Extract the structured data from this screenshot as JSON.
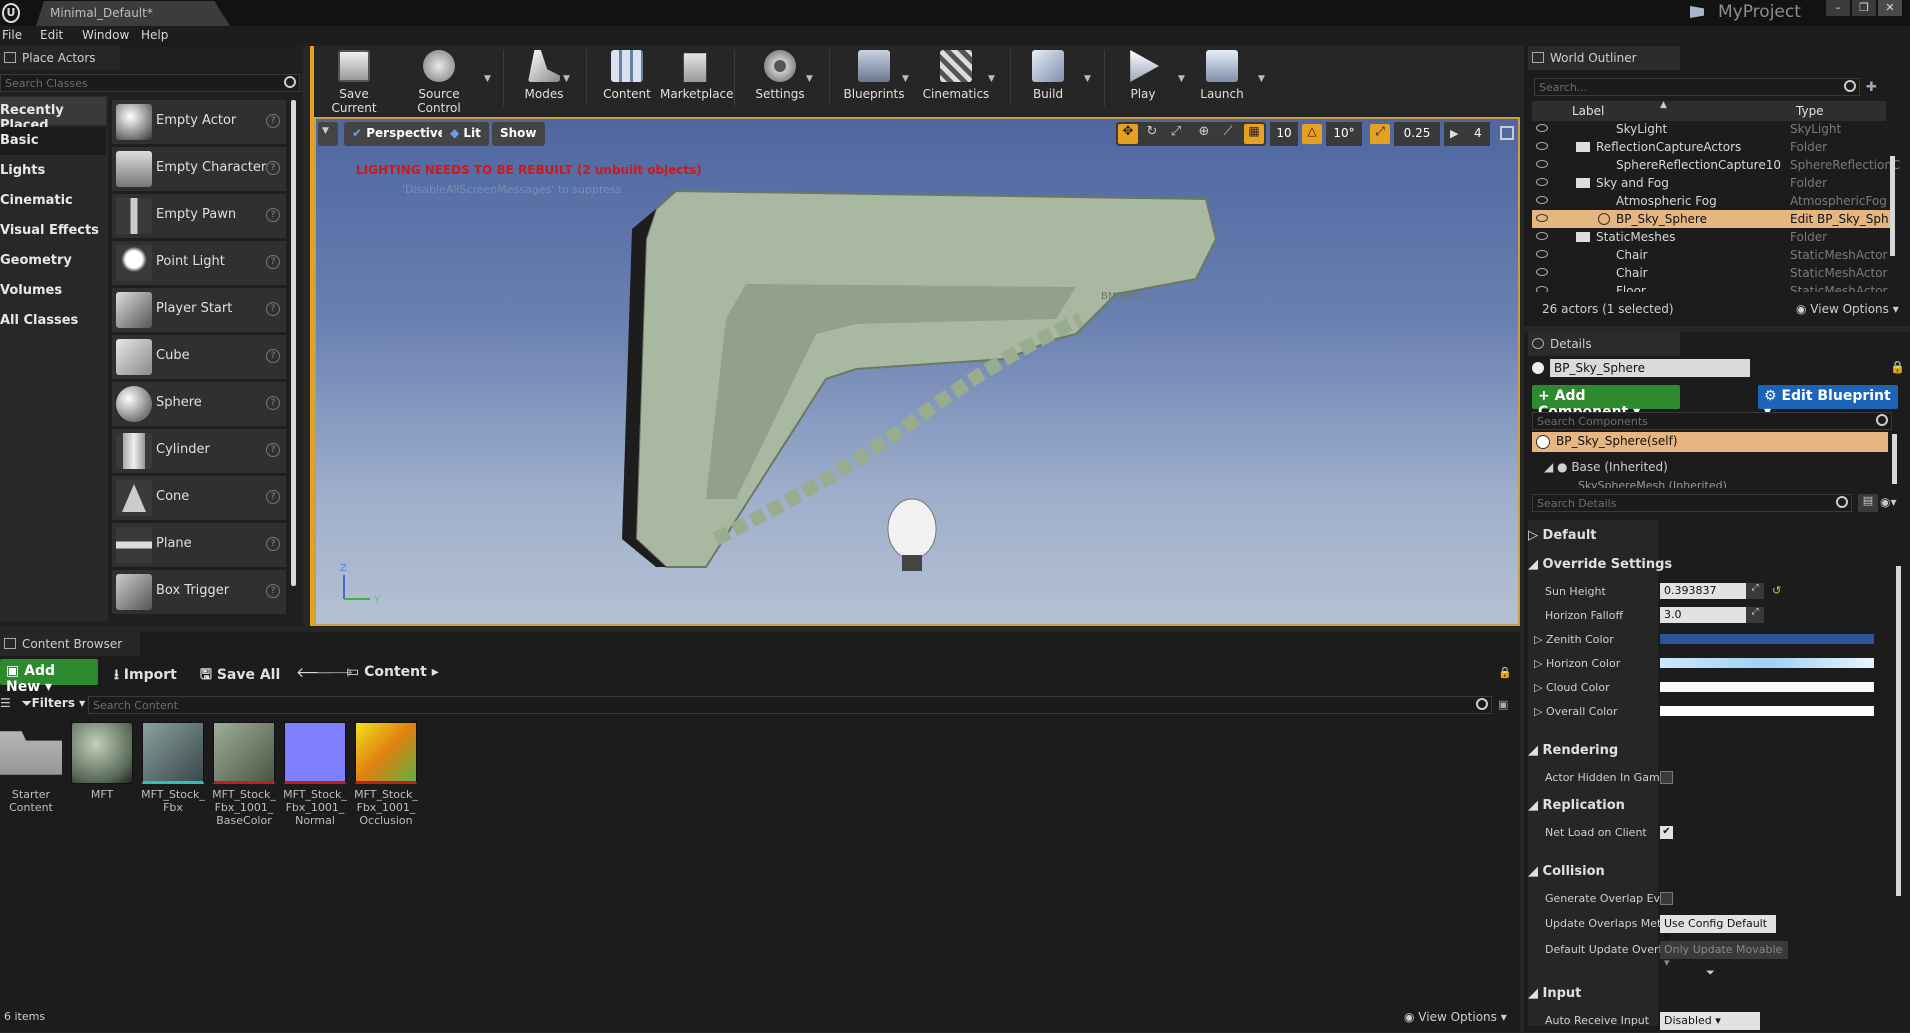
{
  "window": {
    "tab_title": "Minimal_Default*",
    "project": "MyProject",
    "controls": [
      "–",
      "❐",
      "✕"
    ]
  },
  "menu": [
    "File",
    "Edit",
    "Window",
    "Help"
  ],
  "place_actors": {
    "tab": "Place Actors",
    "search_placeholder": "Search Classes",
    "categories": [
      "Recently Placed",
      "Basic",
      "Lights",
      "Cinematic",
      "Visual Effects",
      "Geometry",
      "Volumes",
      "All Classes"
    ],
    "actors": [
      "Empty Actor",
      "Empty Character",
      "Empty Pawn",
      "Point Light",
      "Player Start",
      "Cube",
      "Sphere",
      "Cylinder",
      "Cone",
      "Plane",
      "Box Trigger"
    ]
  },
  "toolbar": [
    {
      "label": "Save Current",
      "icon": "save-icon"
    },
    {
      "label": "Source Control",
      "icon": "source-control-icon"
    },
    {
      "label": "Modes",
      "icon": "modes-icon"
    },
    {
      "label": "Content",
      "icon": "content-icon"
    },
    {
      "label": "Marketplace",
      "icon": "marketplace-icon"
    },
    {
      "label": "Settings",
      "icon": "settings-icon"
    },
    {
      "label": "Blueprints",
      "icon": "blueprints-icon"
    },
    {
      "label": "Cinematics",
      "icon": "cinematics-icon"
    },
    {
      "label": "Build",
      "icon": "build-icon"
    },
    {
      "label": "Play",
      "icon": "play-icon"
    },
    {
      "label": "Launch",
      "icon": "launch-icon"
    }
  ],
  "viewport": {
    "perspective": "Perspective",
    "lit": "Lit",
    "show": "Show",
    "warning": "LIGHTING NEEDS TO BE REBUILT (2 unbuilt objects)",
    "warning_sub": "'DisableAllScreenMessages' to suppress",
    "grid_snap": "10",
    "rot_snap": "10°",
    "scale_snap": "0.25",
    "cam_speed": "4",
    "model_mark": "BMSMIL",
    "axis_z": "Z",
    "axis_y": "Y",
    "colors": {
      "sky_top": "#5a6fa2",
      "sky_bottom": "#a9b6c9",
      "model": "#a8b79e"
    }
  },
  "outliner": {
    "tab": "World Outliner",
    "search_placeholder": "Search...",
    "col_label": "Label",
    "col_type": "Type",
    "rows": [
      {
        "label": "SkyLight",
        "type": "SkyLight"
      },
      {
        "label": "ReflectionCaptureActors",
        "type": "Folder"
      },
      {
        "label": "SphereReflectionCapture10",
        "type": "SphereReflectionC"
      },
      {
        "label": "Sky and Fog",
        "type": "Folder"
      },
      {
        "label": "Atmospheric Fog",
        "type": "AtmosphericFog"
      },
      {
        "label": "BP_Sky_Sphere",
        "type": "Edit BP_Sky_Sph"
      },
      {
        "label": "StaticMeshes",
        "type": "Folder"
      },
      {
        "label": "Chair",
        "type": "StaticMeshActor"
      },
      {
        "label": "Chair",
        "type": "StaticMeshActor"
      },
      {
        "label": "Floor",
        "type": "StaticMeshActor"
      }
    ],
    "count": "26 actors (1 selected)",
    "view_options": "View Options"
  },
  "details": {
    "tab": "Details",
    "name": "BP_Sky_Sphere",
    "add_component": "Add Component",
    "edit_blueprint": "Edit Blueprint",
    "search_components": "Search Components",
    "comp_self": "BP_Sky_Sphere(self)",
    "comp_base": "Base (Inherited)",
    "comp_child": "SkySphereMesh (Inherited)",
    "search_details": "Search Details",
    "sec_default": "Default",
    "sec_override": "Override Settings",
    "sun_height_label": "Sun Height",
    "sun_height": "0.393837",
    "horizon_falloff_label": "Horizon Falloff",
    "horizon_falloff": "3.0",
    "zenith_label": "Zenith Color",
    "horizon_color_label": "Horizon Color",
    "cloud_label": "Cloud Color",
    "overall_label": "Overall Color",
    "zenith_color": "#2c5596",
    "sec_rendering": "Rendering",
    "hidden_label": "Actor Hidden In Game",
    "sec_replication": "Replication",
    "net_load_label": "Net Load on Client",
    "sec_collision": "Collision",
    "gen_overlap_label": "Generate Overlap Ever",
    "update_method_label": "Update Overlaps Meth",
    "update_method": "Use Config Default",
    "default_update_label": "Default Update Overla",
    "default_update": "Only Update Movable",
    "sec_input": "Input",
    "auto_receive_label": "Auto Receive Input",
    "auto_receive": "Disabled"
  },
  "content_browser": {
    "tab": "Content Browser",
    "add_new": "Add New",
    "import": "Import",
    "save_all": "Save All",
    "path": "Content",
    "filters": "Filters",
    "search_placeholder": "Search Content",
    "assets": [
      {
        "label": "Starter Content"
      },
      {
        "label": "MFT"
      },
      {
        "label": "MFT_Stock_ Fbx"
      },
      {
        "label": "MFT_Stock_ Fbx_1001_ BaseColor"
      },
      {
        "label": "MFT_Stock_ Fbx_1001_ Normal"
      },
      {
        "label": "MFT_Stock_ Fbx_1001_ Occlusion"
      }
    ],
    "count": "6 items",
    "view_options": "View Options"
  }
}
